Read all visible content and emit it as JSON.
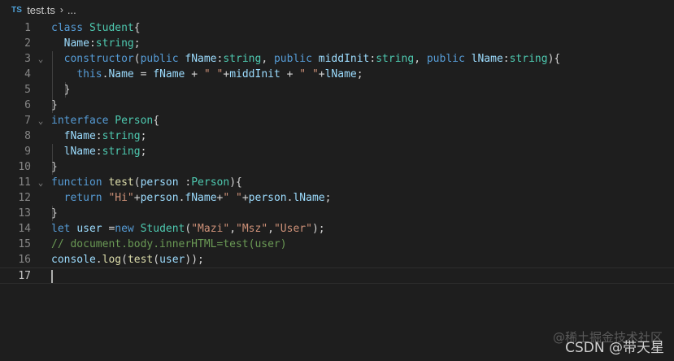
{
  "breadcrumb": {
    "badge": "TS",
    "file": "test.ts",
    "separator": "›",
    "ellipsis": "..."
  },
  "editor": {
    "active_line": 17,
    "lines": [
      {
        "n": "1",
        "fold": "",
        "tokens": [
          [
            "kw",
            "class "
          ],
          [
            "ty",
            "Student"
          ],
          [
            "pl",
            "{"
          ]
        ]
      },
      {
        "n": "2",
        "fold": "",
        "tokens": [
          [
            "pl",
            "  "
          ],
          [
            "va",
            "Name"
          ],
          [
            "pl",
            ":"
          ],
          [
            "ty",
            "string"
          ],
          [
            "pl",
            ";"
          ]
        ]
      },
      {
        "n": "3",
        "fold": "⌄",
        "tokens": [
          [
            "pl",
            "  "
          ],
          [
            "kw",
            "constructor"
          ],
          [
            "pl",
            "("
          ],
          [
            "kw",
            "public "
          ],
          [
            "va",
            "fName"
          ],
          [
            "pl",
            ":"
          ],
          [
            "ty",
            "string"
          ],
          [
            "pl",
            ", "
          ],
          [
            "kw",
            "public "
          ],
          [
            "va",
            "middInit"
          ],
          [
            "pl",
            ":"
          ],
          [
            "ty",
            "string"
          ],
          [
            "pl",
            ", "
          ],
          [
            "kw",
            "public "
          ],
          [
            "va",
            "lName"
          ],
          [
            "pl",
            ":"
          ],
          [
            "ty",
            "string"
          ],
          [
            "pl",
            "){"
          ]
        ]
      },
      {
        "n": "4",
        "fold": "",
        "tokens": [
          [
            "pl",
            "    "
          ],
          [
            "kw",
            "this"
          ],
          [
            "pl",
            "."
          ],
          [
            "va",
            "Name"
          ],
          [
            "pl",
            " = "
          ],
          [
            "va",
            "fName"
          ],
          [
            "pl",
            " + "
          ],
          [
            "st",
            "\" \""
          ],
          [
            "pl",
            "+"
          ],
          [
            "va",
            "middInit"
          ],
          [
            "pl",
            " + "
          ],
          [
            "st",
            "\" \""
          ],
          [
            "pl",
            "+"
          ],
          [
            "va",
            "lName"
          ],
          [
            "pl",
            ";"
          ]
        ]
      },
      {
        "n": "5",
        "fold": "",
        "tokens": [
          [
            "pl",
            "  }"
          ]
        ]
      },
      {
        "n": "6",
        "fold": "",
        "tokens": [
          [
            "pl",
            "}"
          ]
        ]
      },
      {
        "n": "7",
        "fold": "⌄",
        "tokens": [
          [
            "kw",
            "interface "
          ],
          [
            "ty",
            "Person"
          ],
          [
            "pl",
            "{"
          ]
        ]
      },
      {
        "n": "8",
        "fold": "",
        "tokens": [
          [
            "pl",
            "  "
          ],
          [
            "va",
            "fName"
          ],
          [
            "pl",
            ":"
          ],
          [
            "ty",
            "string"
          ],
          [
            "pl",
            ";"
          ]
        ]
      },
      {
        "n": "9",
        "fold": "",
        "tokens": [
          [
            "pl",
            "  "
          ],
          [
            "va",
            "lName"
          ],
          [
            "pl",
            ":"
          ],
          [
            "ty",
            "string"
          ],
          [
            "pl",
            ";"
          ]
        ]
      },
      {
        "n": "10",
        "fold": "",
        "tokens": [
          [
            "pl",
            "}"
          ]
        ]
      },
      {
        "n": "11",
        "fold": "⌄",
        "tokens": [
          [
            "kw",
            "function "
          ],
          [
            "fn",
            "test"
          ],
          [
            "pl",
            "("
          ],
          [
            "va",
            "person "
          ],
          [
            "pl",
            ":"
          ],
          [
            "ty",
            "Person"
          ],
          [
            "pl",
            "){"
          ]
        ]
      },
      {
        "n": "12",
        "fold": "",
        "tokens": [
          [
            "pl",
            "  "
          ],
          [
            "kw",
            "return "
          ],
          [
            "st",
            "\"Hi\""
          ],
          [
            "pl",
            "+"
          ],
          [
            "va",
            "person"
          ],
          [
            "pl",
            "."
          ],
          [
            "va",
            "fName"
          ],
          [
            "pl",
            "+"
          ],
          [
            "st",
            "\" \""
          ],
          [
            "pl",
            "+"
          ],
          [
            "va",
            "person"
          ],
          [
            "pl",
            "."
          ],
          [
            "va",
            "lName"
          ],
          [
            "pl",
            ";"
          ]
        ]
      },
      {
        "n": "13",
        "fold": "",
        "tokens": [
          [
            "pl",
            "}"
          ]
        ]
      },
      {
        "n": "14",
        "fold": "",
        "tokens": [
          [
            "kw",
            "let "
          ],
          [
            "va",
            "user "
          ],
          [
            "pl",
            "="
          ],
          [
            "kw",
            "new "
          ],
          [
            "ty",
            "Student"
          ],
          [
            "pl",
            "("
          ],
          [
            "st",
            "\"Mazi\""
          ],
          [
            "pl",
            ","
          ],
          [
            "st",
            "\"Msz\""
          ],
          [
            "pl",
            ","
          ],
          [
            "st",
            "\"User\""
          ],
          [
            "pl",
            ");"
          ]
        ]
      },
      {
        "n": "15",
        "fold": "",
        "tokens": [
          [
            "cm",
            "// document.body.innerHTML=test(user)"
          ]
        ]
      },
      {
        "n": "16",
        "fold": "",
        "tokens": [
          [
            "va",
            "console"
          ],
          [
            "pl",
            "."
          ],
          [
            "fn",
            "log"
          ],
          [
            "pl",
            "("
          ],
          [
            "fn",
            "test"
          ],
          [
            "pl",
            "("
          ],
          [
            "va",
            "user"
          ],
          [
            "pl",
            "));"
          ]
        ]
      },
      {
        "n": "17",
        "fold": "",
        "tokens": []
      }
    ]
  },
  "watermark": {
    "line1": "@稀土掘金技术社区",
    "line2": "CSDN @带天星"
  },
  "colors": {
    "background": "#1e1e1e",
    "keyword": "#569cd6",
    "type": "#4ec9b0",
    "function": "#dcdcaa",
    "variable": "#9cdcfe",
    "string": "#ce9178",
    "comment": "#6a9955",
    "text": "#d4d4d4",
    "line_number": "#858585"
  }
}
